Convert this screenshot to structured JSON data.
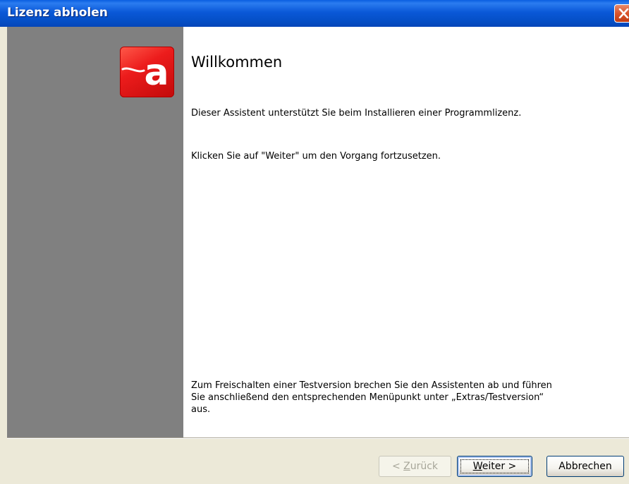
{
  "window": {
    "title": "Lizenz abholen"
  },
  "page": {
    "heading": "Willkommen",
    "intro": "Dieser Assistent unterstützt Sie beim Installieren einer Programmlizenz.",
    "instruction": "Klicken Sie auf \"Weiter\" um den Vorgang fortzusetzen.",
    "note_lines": [
      "Zum Freischalten einer Testversion brechen Sie den Assistenten ab und führen",
      "Sie anschließend den entsprechenden Menüpunkt unter „Extras/Testversion“",
      "aus."
    ]
  },
  "logo": {
    "letter": "a",
    "icon": "brand-logo-icon",
    "color": "#e8161a"
  },
  "buttons": {
    "back": {
      "accel": "Z",
      "prefix": "< ",
      "rest": "urück",
      "enabled": false
    },
    "next": {
      "accel": "W",
      "rest": "eiter >",
      "enabled": true,
      "default": true
    },
    "cancel": {
      "label": "Abbrechen",
      "enabled": true
    }
  },
  "colors": {
    "titlebar": "#0a58d8",
    "sidebar": "#808080",
    "content_bg": "#ffffff",
    "dialog_bg": "#ece9d8"
  }
}
